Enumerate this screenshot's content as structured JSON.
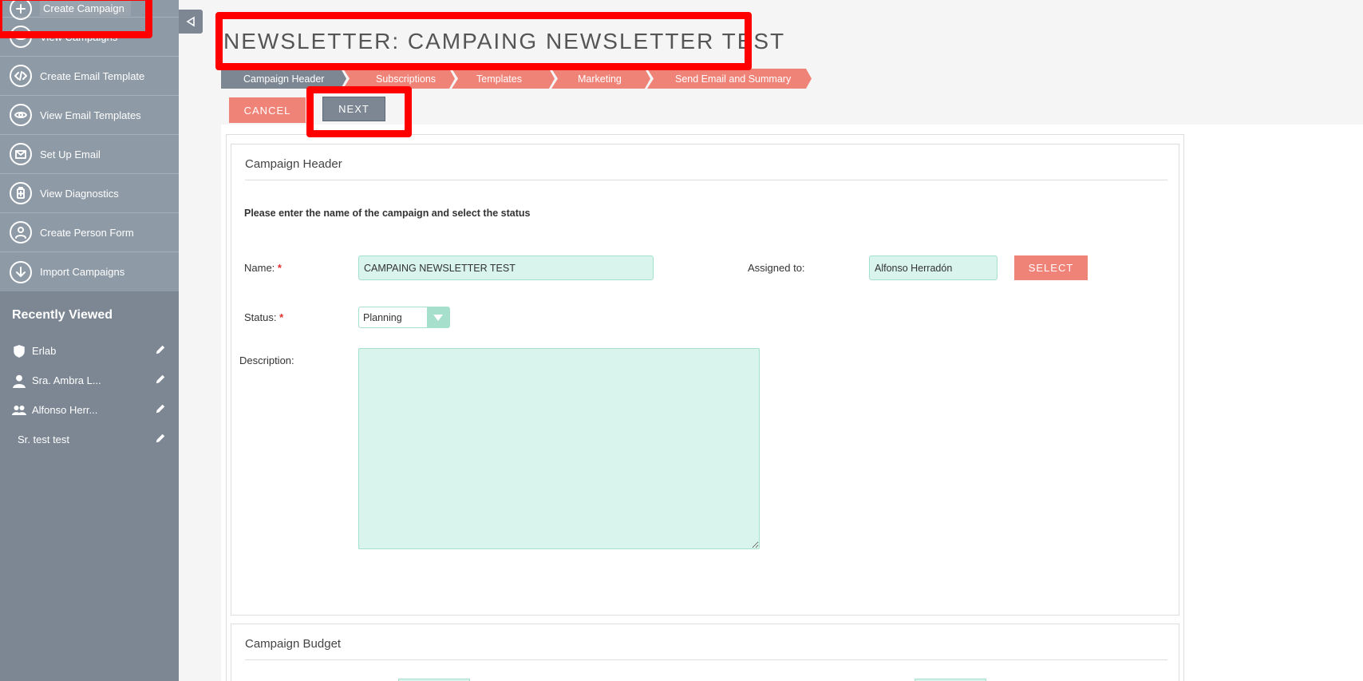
{
  "sidebar": {
    "actions": [
      {
        "label": "Create Campaign",
        "icon": "plus-icon"
      },
      {
        "label": "View Campaigns",
        "icon": "eye-icon"
      },
      {
        "label": "Create Email Template",
        "icon": "code-icon"
      },
      {
        "label": "View Email Templates",
        "icon": "eye-icon"
      },
      {
        "label": "Set Up Email",
        "icon": "envelope-icon"
      },
      {
        "label": "View Diagnostics",
        "icon": "diagnostics-icon"
      },
      {
        "label": "Create Person Form",
        "icon": "person-icon"
      },
      {
        "label": "Import Campaigns",
        "icon": "download-icon"
      }
    ],
    "recently_viewed_title": "Recently Viewed",
    "recently_viewed": [
      {
        "label": "Erlab",
        "icon": "shield-icon"
      },
      {
        "label": "Sra. Ambra L...",
        "icon": "person-icon"
      },
      {
        "label": "Alfonso Herr...",
        "icon": "group-icon"
      },
      {
        "label": "Sr. test test",
        "icon": ""
      }
    ]
  },
  "page": {
    "title": "NEWSLETTER: CAMPAING NEWSLETTER TEST"
  },
  "wizard": {
    "steps": [
      "Campaign Header",
      "Subscriptions",
      "Templates",
      "Marketing",
      "Send Email and Summary"
    ],
    "active_step": "Campaign Header"
  },
  "buttons": {
    "cancel": "CANCEL",
    "next": "NEXT",
    "select": "SELECT"
  },
  "form": {
    "section_title": "Campaign Header",
    "instructions": "Please enter the name of the campaign and select the status",
    "name_label": "Name:",
    "name_value": "CAMPAING NEWSLETTER TEST",
    "assigned_label": "Assigned to:",
    "assigned_value": "Alfonso Herradón",
    "status_label": "Status:",
    "status_value": "Planning",
    "description_label": "Description:",
    "description_value": "",
    "required_mark": "*"
  },
  "budget": {
    "section_title": "Campaign Budget"
  },
  "colors": {
    "sidebar_bg": "#7c8793",
    "accent_coral": "#f08377",
    "input_mint": "#d8f4ec",
    "highlight": "#ff0000"
  }
}
